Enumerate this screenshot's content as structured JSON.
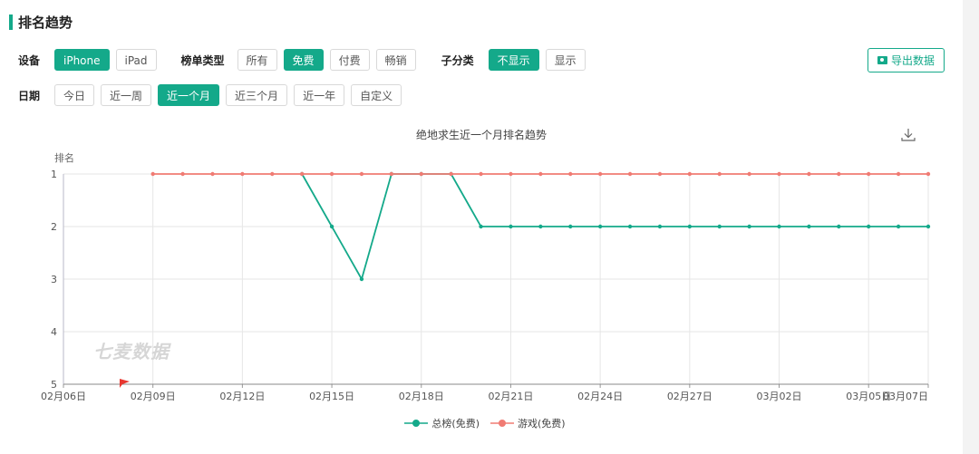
{
  "section_title": "排名趋势",
  "filters": {
    "device_label": "设备",
    "device_options": [
      "iPhone",
      "iPad"
    ],
    "list_type_label": "榜单类型",
    "list_type_options": [
      "所有",
      "免费",
      "付费",
      "畅销"
    ],
    "subcat_label": "子分类",
    "subcat_options": [
      "不显示",
      "显示"
    ],
    "date_label": "日期",
    "date_options": [
      "今日",
      "近一周",
      "近一个月",
      "近三个月",
      "近一年",
      "自定义"
    ],
    "export_label": "导出数据"
  },
  "watermark": "七麦数据",
  "colors": {
    "accent": "#14a98a",
    "series_green": "#14a98a",
    "series_red": "#f07b73"
  },
  "chart_data": {
    "type": "line",
    "title": "绝地求生近一个月排名趋势",
    "ylabel": "排名",
    "y_inverted": true,
    "ylim": [
      1,
      5
    ],
    "yticks": [
      "1",
      "2",
      "3",
      "4",
      "5"
    ],
    "x_range": [
      "02月06日",
      "03月07日"
    ],
    "x_ticks": [
      "02月06日",
      "02月09日",
      "02月12日",
      "02月15日",
      "02月18日",
      "02月21日",
      "02月24日",
      "02月27日",
      "03月02日",
      "03月05日",
      "03月07日"
    ],
    "dates": [
      "02月09日",
      "02月10日",
      "02月11日",
      "02月12日",
      "02月13日",
      "02月14日",
      "02月15日",
      "02月16日",
      "02月17日",
      "02月18日",
      "02月19日",
      "02月20日",
      "02月21日",
      "02月22日",
      "02月23日",
      "02月24日",
      "02月25日",
      "02月26日",
      "02月27日",
      "02月28日",
      "03月01日",
      "03月02日",
      "03月03日",
      "03月04日",
      "03月05日",
      "03月06日",
      "03月07日"
    ],
    "series": [
      {
        "name": "总榜(免费)",
        "color": "#14a98a",
        "values": [
          null,
          null,
          null,
          null,
          null,
          1,
          2,
          3,
          1,
          1,
          1,
          2,
          2,
          2,
          2,
          2,
          2,
          2,
          2,
          2,
          2,
          2,
          2,
          2,
          2,
          2,
          2
        ]
      },
      {
        "name": "游戏(免费)",
        "color": "#f07b73",
        "values": [
          1,
          1,
          1,
          1,
          1,
          1,
          1,
          1,
          1,
          1,
          1,
          1,
          1,
          1,
          1,
          1,
          1,
          1,
          1,
          1,
          1,
          1,
          1,
          1,
          1,
          1,
          1
        ]
      }
    ],
    "grid": true,
    "legend_position": "bottom"
  }
}
